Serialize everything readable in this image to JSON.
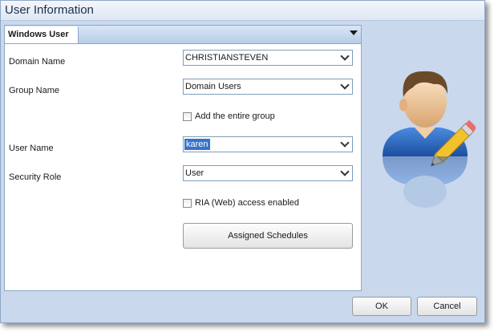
{
  "window": {
    "title": "User Information"
  },
  "tab": {
    "label": "Windows User"
  },
  "form": {
    "domain_label": "Domain Name",
    "domain_value": "CHRISTIANSTEVEN",
    "group_label": "Group Name",
    "group_value": "Domain Users",
    "add_group_label": "Add the entire group",
    "user_label": "User Name",
    "user_value": "karen",
    "role_label": "Security Role",
    "role_value": "User",
    "ria_label": "RIA (Web) access enabled",
    "schedules_button": "Assigned Schedules"
  },
  "footer": {
    "ok": "OK",
    "cancel": "Cancel"
  },
  "icons": {
    "avatar": "user-edit-icon",
    "tab_menu": "chevron-down-icon",
    "combo": "chevron-down-icon"
  }
}
